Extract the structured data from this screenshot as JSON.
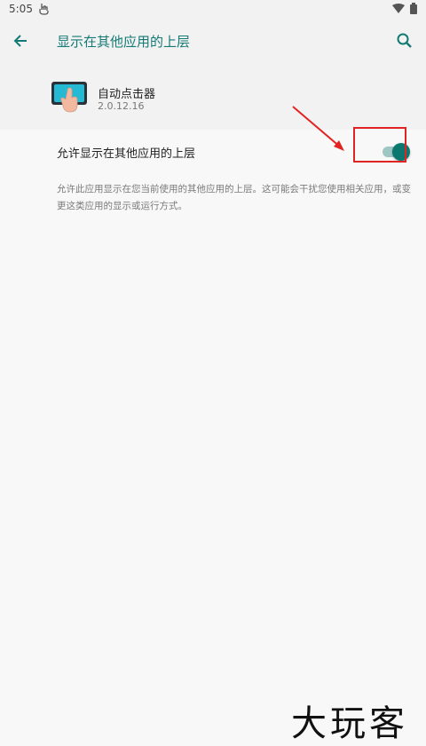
{
  "status_bar": {
    "time": "5:05"
  },
  "app_bar": {
    "title": "显示在其他应用的上层"
  },
  "app_info": {
    "name": "自动点击器",
    "version": "2.0.12.16"
  },
  "setting": {
    "label": "允许显示在其他应用的上层",
    "enabled": true,
    "description": "允许此应用显示在您当前使用的其他应用的上层。这可能会干扰您使用相关应用，或变更这类应用的显示或运行方式。"
  },
  "colors": {
    "accent": "#137a74",
    "switch_thumb": "#0b776e",
    "annotation": "#e02424"
  },
  "icons": [
    "back-arrow-icon",
    "search-icon",
    "gesture-hand-icon",
    "wifi-icon",
    "battery-icon",
    "app-icon"
  ],
  "watermark": "大玩客"
}
